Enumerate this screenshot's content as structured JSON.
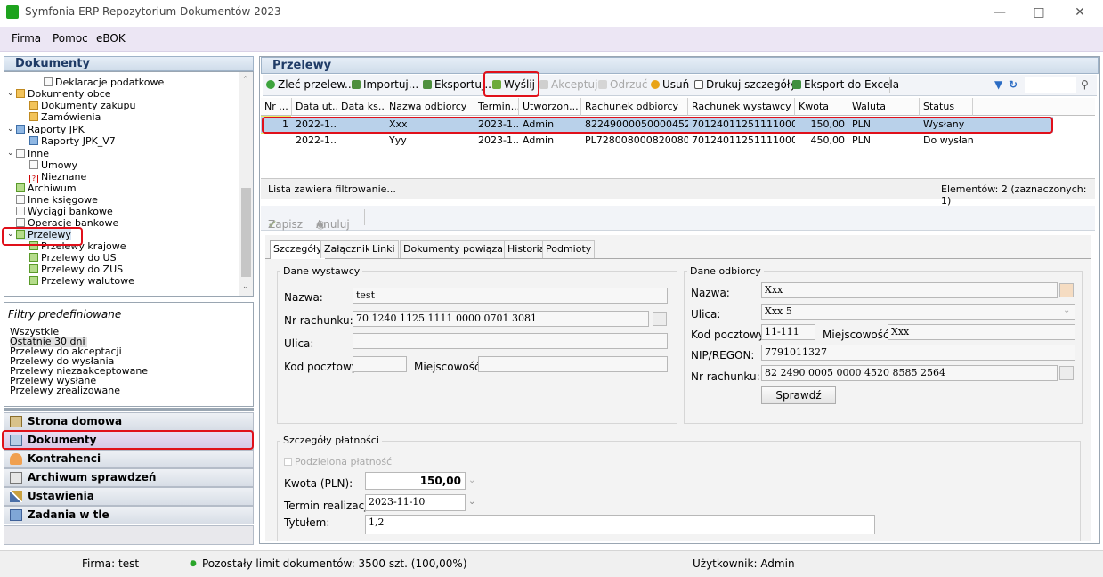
{
  "app": {
    "title": "Symfonia ERP Repozytorium Dokumentów 2023"
  },
  "menu": [
    "Firma",
    "Pomoc",
    "eBOK"
  ],
  "left": {
    "header": "Dokumenty",
    "tree": [
      "Deklaracje podatkowe",
      "Dokumenty obce",
      "Dokumenty zakupu",
      "Zamówienia",
      "Raporty JPK",
      "Raporty JPK_V7",
      "Inne",
      "Umowy",
      "Nieznane",
      "Archiwum",
      "Inne księgowe",
      "Wyciągi bankowe",
      "Operacje bankowe",
      "Przelewy",
      "Przelewy krajowe",
      "Przelewy do US",
      "Przelewy do ZUS",
      "Przelewy walutowe"
    ],
    "filters_title": "Filtry predefiniowane",
    "filters": [
      "Wszystkie",
      "Ostatnie 30 dni",
      "Przelewy do akceptacji",
      "Przelewy do wysłania",
      "Przelewy niezaakceptowane",
      "Przelewy wysłane",
      "Przelewy zrealizowane"
    ],
    "nav": [
      "Strona domowa",
      "Dokumenty",
      "Kontrahenci",
      "Archiwum sprawdzeń",
      "Ustawienia",
      "Zadania w tle"
    ]
  },
  "main": {
    "header": "Przelewy",
    "toolbar": {
      "zlec": "Zleć przelew...",
      "importuj": "Importuj...",
      "eksportuj": "Eksportuj...",
      "wyslij": "Wyślij",
      "akceptuj": "Akceptuj",
      "odrzuc": "Odrzuć",
      "usun": "Usuń",
      "drukuj": "Drukuj szczegóły",
      "excel": "Eksport do Excela"
    },
    "columns": [
      "Nr ...",
      "Data ut...",
      "Data ks...",
      "Nazwa odbiorcy",
      "Termin...",
      "Utworzon...",
      "Rachunek odbiorcy",
      "Rachunek wystawcy",
      "Kwota",
      "Waluta",
      "Status"
    ],
    "rows": [
      [
        "1",
        "2022-1...",
        "",
        "Xxx",
        "2023-1...",
        "Admin",
        "82249000050000452...",
        "70124011251111000...",
        "150,00",
        "PLN",
        "Wysłany"
      ],
      [
        "",
        "2022-1...",
        "",
        "Yyy",
        "2023-1...",
        "Admin",
        "PL728008000820080...",
        "70124011251111000...",
        "450,00",
        "PLN",
        "Do wysłania"
      ]
    ],
    "footer_left": "Lista zawiera filtrowanie...",
    "footer_right": "Elementów: 2 (zaznaczonych: 1)",
    "save": "Zapisz",
    "cancel": "Anuluj"
  },
  "detail": {
    "tabs": [
      "Szczegóły",
      "Załączniki",
      "Linki",
      "Dokumenty powiązane",
      "Historia",
      "Podmioty"
    ],
    "wystawca": {
      "title": "Dane wystawcy",
      "nazwa_label": "Nazwa:",
      "nazwa": "test",
      "rachunek_label": "Nr rachunku:",
      "rachunek": "70 1240 1125 1111 0000 0701 3081",
      "ulica_label": "Ulica:",
      "ulica": "",
      "kod_label": "Kod pocztowy:",
      "kod": "",
      "miejsc_label": "Miejscowość:",
      "miejsc": ""
    },
    "odbiorca": {
      "title": "Dane odbiorcy",
      "nazwa_label": "Nazwa:",
      "nazwa": "Xxx",
      "ulica_label": "Ulica:",
      "ulica": "Xxx 5",
      "kod_label": "Kod pocztowy:",
      "kod": "11-111",
      "miejsc_label": "Miejscowość:",
      "miejsc": "Xxx",
      "nip_label": "NIP/REGON:",
      "nip": "7791011327",
      "rachunek_label": "Nr rachunku:",
      "rachunek": "82 2490 0005 0000 4520 8585 2564",
      "sprawdz": "Sprawdź"
    },
    "platnosc": {
      "title": "Szczegóły płatności",
      "podzielona": "Podzielona płatność",
      "kwota_label": "Kwota (PLN):",
      "kwota": "150,00",
      "termin_label": "Termin realizacji:",
      "termin": "2023-11-10",
      "tytul_label": "Tytułem:",
      "tytul": "1,2"
    }
  },
  "status": {
    "firma": "Firma: test",
    "limit": "Pozostały limit dokumentów: 3500 szt. (100,00%)",
    "user": "Użytkownik: Admin"
  }
}
